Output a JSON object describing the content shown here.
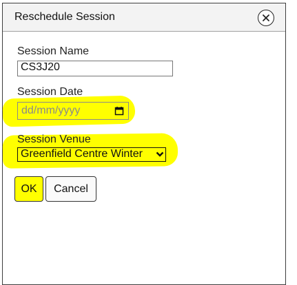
{
  "dialog": {
    "title": "Reschedule Session",
    "close_icon": "close-circle-icon"
  },
  "form": {
    "session_name": {
      "label": "Session Name",
      "value": "CS3J20"
    },
    "session_date": {
      "label": "Session Date",
      "placeholder": "dd/mm/yyyy",
      "icon": "calendar-icon"
    },
    "session_venue": {
      "label": "Session Venue",
      "selected": "Greenfield Centre Winter",
      "icon": "chevron-down-icon"
    }
  },
  "actions": {
    "ok_label": "OK",
    "cancel_label": "Cancel"
  },
  "colors": {
    "highlight": "#ffff00",
    "titlebar_bg": "#f3f3f3",
    "border": "#3c3c3c"
  }
}
